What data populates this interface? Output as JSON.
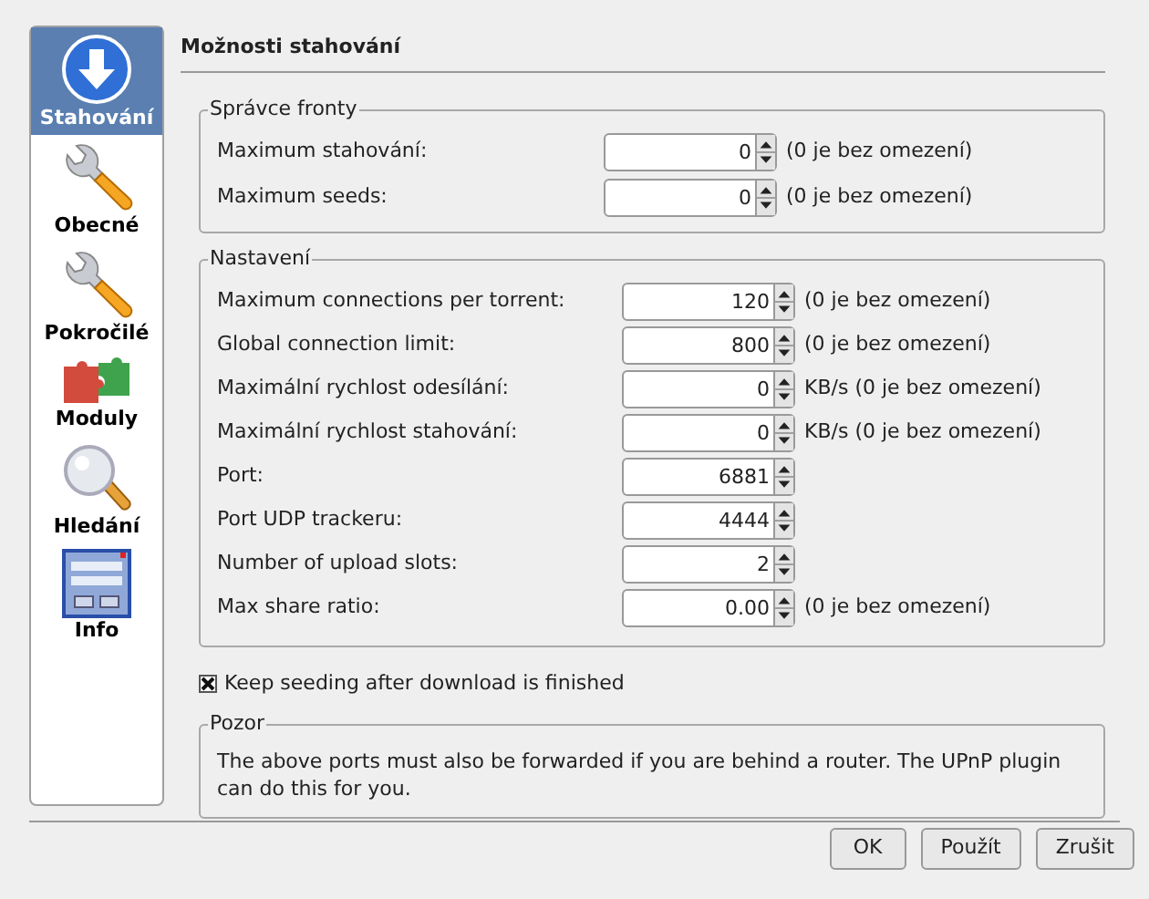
{
  "sidebar": {
    "items": [
      {
        "label": "Stahování",
        "selected": true
      },
      {
        "label": "Obecné",
        "selected": false
      },
      {
        "label": "Pokročilé",
        "selected": false
      },
      {
        "label": "Moduly",
        "selected": false
      },
      {
        "label": "Hledání",
        "selected": false
      },
      {
        "label": "Info",
        "selected": false
      }
    ]
  },
  "page_title": "Možnosti stahování",
  "groups": [
    {
      "title": "Správce fronty",
      "rows": [
        {
          "label": "Maximum stahování:",
          "value": "0",
          "note": "(0 je bez omezení)"
        },
        {
          "label": "Maximum seeds:",
          "value": "0",
          "note": "(0 je bez omezení)"
        }
      ]
    },
    {
      "title": "Nastavení",
      "rows": [
        {
          "label": "Maximum connections per torrent:",
          "value": "120",
          "note": "(0 je bez omezení)"
        },
        {
          "label": "Global connection limit:",
          "value": "800",
          "note": "(0 je bez omezení)"
        },
        {
          "label": "Maximální rychlost odesílání:",
          "value": "0",
          "note": "KB/s (0 je bez omezení)"
        },
        {
          "label": "Maximální rychlost stahování:",
          "value": "0",
          "note": "KB/s (0 je bez omezení)"
        },
        {
          "label": "Port:",
          "value": "6881"
        },
        {
          "label": "Port UDP trackeru:",
          "value": "4444"
        },
        {
          "label": "Number of upload slots:",
          "value": "2"
        },
        {
          "label": "Max share ratio:",
          "value": "0.00",
          "note": "(0 je bez omezení)"
        }
      ]
    }
  ],
  "keep_seeding": {
    "label": "Keep seeding after download is finished",
    "checked": true
  },
  "notice": {
    "title": "Pozor",
    "text": "The above ports must also be forwarded if you are behind a router. The UPnP plugin can do this for you."
  },
  "buttons": [
    "OK",
    "Použít",
    "Zrušit"
  ]
}
